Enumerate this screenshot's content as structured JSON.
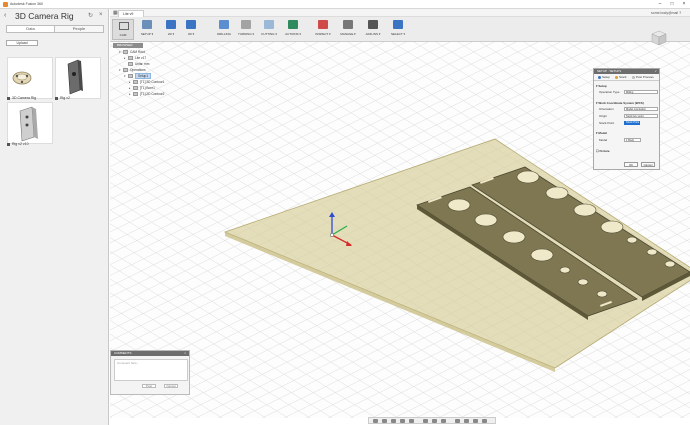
{
  "window": {
    "title": "Autodesk Fusion 360",
    "minimize": "–",
    "maximize": "□",
    "close": "×"
  },
  "data_panel": {
    "project_title": "3D Camera Rig",
    "tabs": [
      {
        "label": "Data"
      },
      {
        "label": "People"
      }
    ],
    "upload_label": "Upload",
    "files": [
      {
        "name": "3D Camera Rig"
      },
      {
        "name": "Rig v2"
      },
      {
        "name": "Rig v2 v10"
      }
    ]
  },
  "topbar": {
    "doc_tab": "Lite v9",
    "user_name": "some.body@mail",
    "help_icon": "?"
  },
  "ribbon": {
    "workspace": "CAM",
    "tools": [
      {
        "label": "SETUP ▾",
        "color": "#6a8fb9"
      },
      {
        "label": "2D ▾",
        "color": "#3b74c2"
      },
      {
        "label": "3D ▾",
        "color": "#3b74c2"
      },
      {
        "label": "DRILLING",
        "color": "#5a8ed0"
      },
      {
        "label": "TURNING ▾",
        "color": "#a3a3a3"
      },
      {
        "label": "CUTTING ▾",
        "color": "#9bb8d9"
      },
      {
        "label": "ACTIONS ▾",
        "color": "#2f8a5e"
      },
      {
        "label": "INSPECT ▾",
        "color": "#d04a4a"
      },
      {
        "label": "MANAGE ▾",
        "color": "#777"
      },
      {
        "label": "ADD-INS ▾",
        "color": "#555"
      },
      {
        "label": "SELECT ▾",
        "color": "#3b74c2"
      }
    ]
  },
  "browser": {
    "header": "BROWSER",
    "rows": [
      {
        "label": "CAM Root"
      },
      {
        "label": "Lite v17"
      },
      {
        "label": "Units: mm"
      },
      {
        "label": "Operations"
      },
      {
        "label": "Setup1"
      },
      {
        "label": "[T1] 2D Contour1"
      },
      {
        "label": "[T1] Bore1"
      },
      {
        "label": "[T1] 2D Contour2"
      }
    ]
  },
  "setup_dialog": {
    "title": "SETUP : SETUP1",
    "ok": "✓",
    "tabs": [
      {
        "label": "Setup",
        "dot": "#3b74c2"
      },
      {
        "label": "Stock",
        "dot": "#d8a23a"
      },
      {
        "label": "Post Process",
        "dot": "#bbb"
      }
    ],
    "section_setup": "▾ Setup",
    "operation_type_label": "Operation Type",
    "operation_type_value": "Milling",
    "section_wcs": "▾ Work Coordinate System (WCS)",
    "orientation_label": "Orientation",
    "orientation_value": "Model orientation",
    "origin_label": "Origin",
    "origin_value": "Stock box point",
    "stock_point_label": "Stock Point",
    "stock_point_value": "Stock Point",
    "section_model": "▾ Model",
    "model_label": "Model",
    "model_value": "1 Body",
    "section_fixture": "☐ Fixture",
    "ok_button": "OK",
    "cancel_button": "Cancel"
  },
  "comments": {
    "title": "COMMENTS",
    "close": "×",
    "placeholder": "Comment here...",
    "post": "Post",
    "cancel": "Cancel"
  }
}
